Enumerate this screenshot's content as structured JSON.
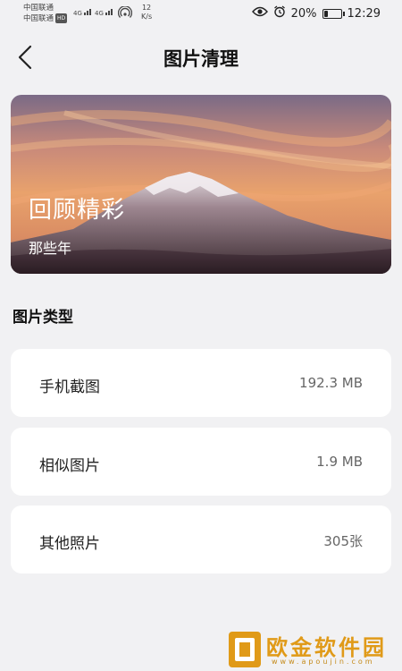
{
  "status_bar": {
    "carrier1": "中国联通",
    "carrier2": "中国联通",
    "hd": "HD",
    "sig1": "4G",
    "sig2": "4G",
    "net_speed_value": "12",
    "net_speed_unit": "K/s",
    "battery": "20%",
    "battery_level": 0.2,
    "time": "12:29",
    "icons": [
      "eye-icon",
      "alarm-icon",
      "battery-icon",
      "signal-icon",
      "hotspot-icon"
    ]
  },
  "header": {
    "title": "图片清理"
  },
  "banner": {
    "title": "回顾精彩",
    "subtitle": "那些年"
  },
  "section": {
    "title": "图片类型"
  },
  "categories": [
    {
      "label": "手机截图",
      "value": "192.3 MB"
    },
    {
      "label": "相似图片",
      "value": "1.9 MB"
    },
    {
      "label": "其他照片",
      "value": "305张"
    }
  ],
  "watermark": {
    "text": "欧金软件园",
    "url": "www.apoujin.com"
  },
  "colors": {
    "background": "#f1f1f3",
    "card": "#ffffff",
    "watermark": "#e09a18"
  }
}
